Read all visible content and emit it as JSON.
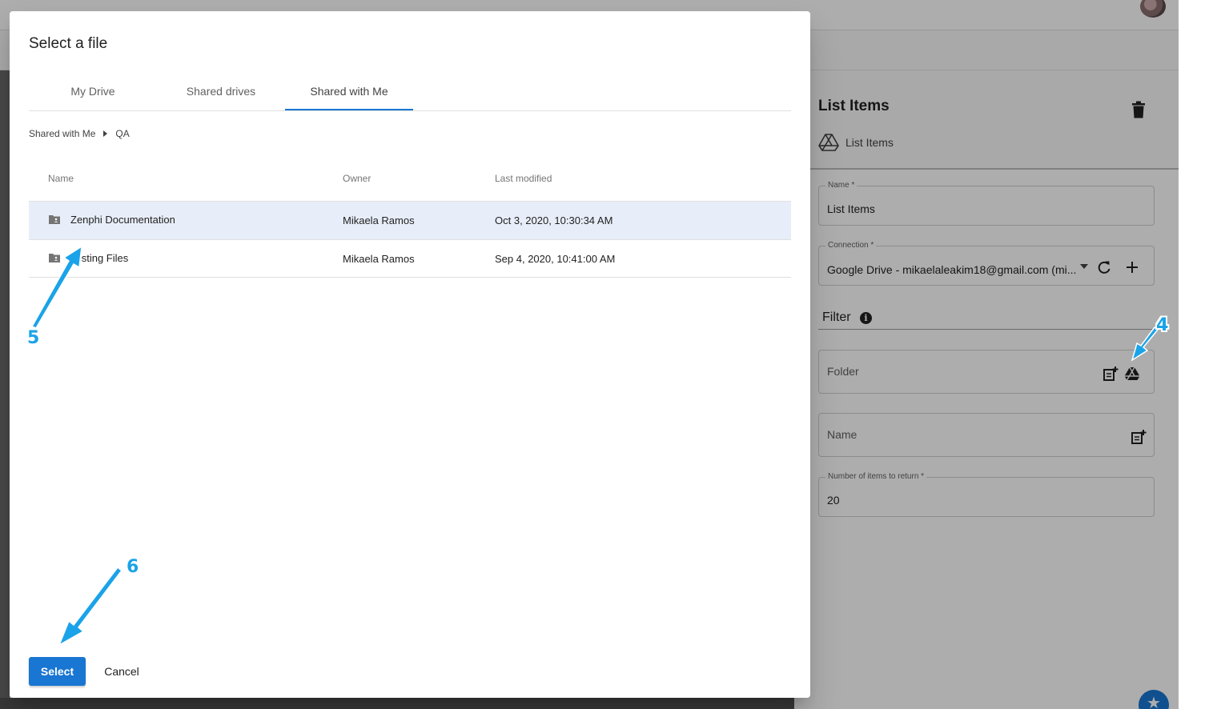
{
  "dialog": {
    "title": "Select a file",
    "tabs": [
      {
        "label": "My Drive"
      },
      {
        "label": "Shared drives"
      },
      {
        "label": "Shared with Me"
      }
    ],
    "active_tab": "Shared with Me",
    "breadcrumb": [
      "Shared with Me",
      "QA"
    ],
    "columns": {
      "name": "Name",
      "owner": "Owner",
      "modified": "Last modified"
    },
    "rows": [
      {
        "name": "Zenphi Documentation",
        "owner": "Mikaela Ramos",
        "modified": "Oct 3, 2020, 10:30:34 AM",
        "selected": true
      },
      {
        "name": "Testing Files",
        "owner": "Mikaela Ramos",
        "modified": "Sep 4, 2020, 10:41:00 AM",
        "selected": false
      }
    ],
    "select_label": "Select",
    "cancel_label": "Cancel"
  },
  "panel": {
    "title": "List Items",
    "subtitle": "List Items",
    "name_field": {
      "label": "Name *",
      "value": "List Items"
    },
    "connection_field": {
      "label": "Connection *",
      "value": "Google Drive - mikaelaleakim18@gmail.com (mi..."
    },
    "filter_label": "Filter",
    "folder_placeholder": "Folder",
    "name_placeholder": "Name",
    "items_field": {
      "label": "Number of items to return *",
      "value": "20"
    }
  },
  "annotations": {
    "step4": "4",
    "step5": "5",
    "step6": "6"
  },
  "colors": {
    "accent": "#1976d2",
    "selected_row": "#e8eef9",
    "annotation": "#1aa3e8"
  }
}
